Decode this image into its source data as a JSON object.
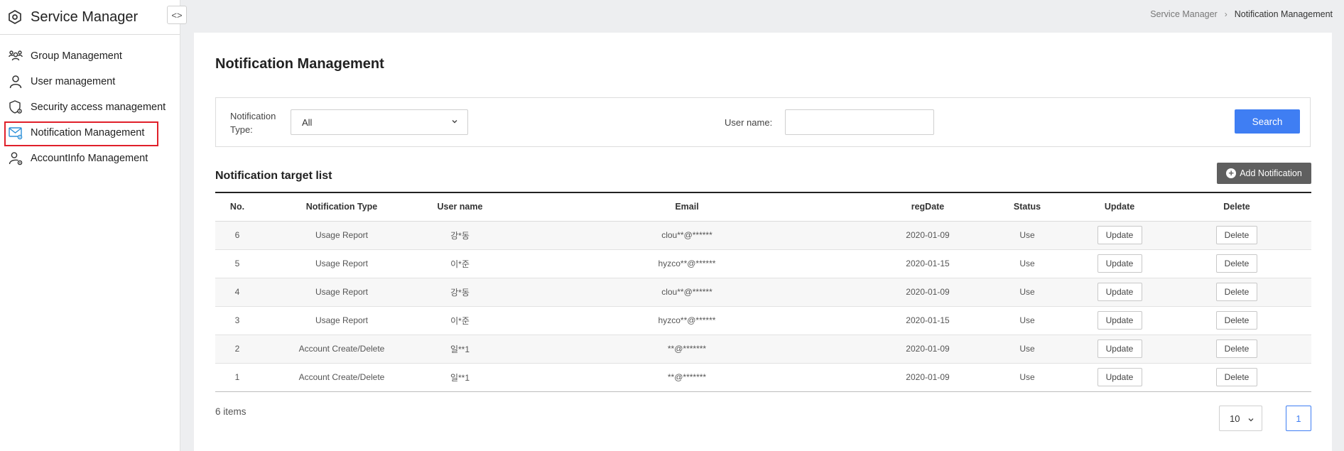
{
  "app": {
    "title": "Service Manager"
  },
  "sidebar": {
    "collapse_label": "<>",
    "items": [
      {
        "label": "Group Management",
        "icon": "group-icon"
      },
      {
        "label": "User management",
        "icon": "user-icon"
      },
      {
        "label": "Security access management",
        "icon": "shield-gear-icon"
      },
      {
        "label": "Notification Management",
        "icon": "mail-gear-icon",
        "active": true
      },
      {
        "label": "AccountInfo Management",
        "icon": "user-gear-icon"
      }
    ]
  },
  "breadcrumb": {
    "root": "Service Manager",
    "separator": "›",
    "current": "Notification Management"
  },
  "page": {
    "title": "Notification Management"
  },
  "filter": {
    "type_label": "Notification Type:",
    "type_value": "All",
    "username_label": "User name:",
    "username_value": "",
    "search_label": "Search"
  },
  "list": {
    "title": "Notification target list",
    "add_label": "Add Notification"
  },
  "table": {
    "headers": {
      "no": "No.",
      "type": "Notification Type",
      "user": "User name",
      "email": "Email",
      "regdate": "regDate",
      "status": "Status",
      "update": "Update",
      "delete": "Delete"
    },
    "update_label": "Update",
    "delete_label": "Delete",
    "rows": [
      {
        "no": "6",
        "type": "Usage Report",
        "user": "강*동",
        "email": "clou**@******",
        "regdate": "2020-01-09",
        "status": "Use"
      },
      {
        "no": "5",
        "type": "Usage Report",
        "user": "이*준",
        "email": "hyzco**@******",
        "regdate": "2020-01-15",
        "status": "Use"
      },
      {
        "no": "4",
        "type": "Usage Report",
        "user": "강*동",
        "email": "clou**@******",
        "regdate": "2020-01-09",
        "status": "Use"
      },
      {
        "no": "3",
        "type": "Usage Report",
        "user": "이*준",
        "email": "hyzco**@******",
        "regdate": "2020-01-15",
        "status": "Use"
      },
      {
        "no": "2",
        "type": "Account Create/Delete",
        "user": "일**1",
        "email": "**@*******",
        "regdate": "2020-01-09",
        "status": "Use"
      },
      {
        "no": "1",
        "type": "Account Create/Delete",
        "user": "일**1",
        "email": "**@*******",
        "regdate": "2020-01-09",
        "status": "Use"
      }
    ]
  },
  "footer": {
    "item_count": "6 items",
    "page_size": "10",
    "current_page": "1"
  },
  "colors": {
    "primary": "#3f7ef3",
    "dark_button": "#5f5f5f",
    "highlight_border": "#e0202a",
    "sidebar_icon_accent": "#2a8fd8"
  }
}
